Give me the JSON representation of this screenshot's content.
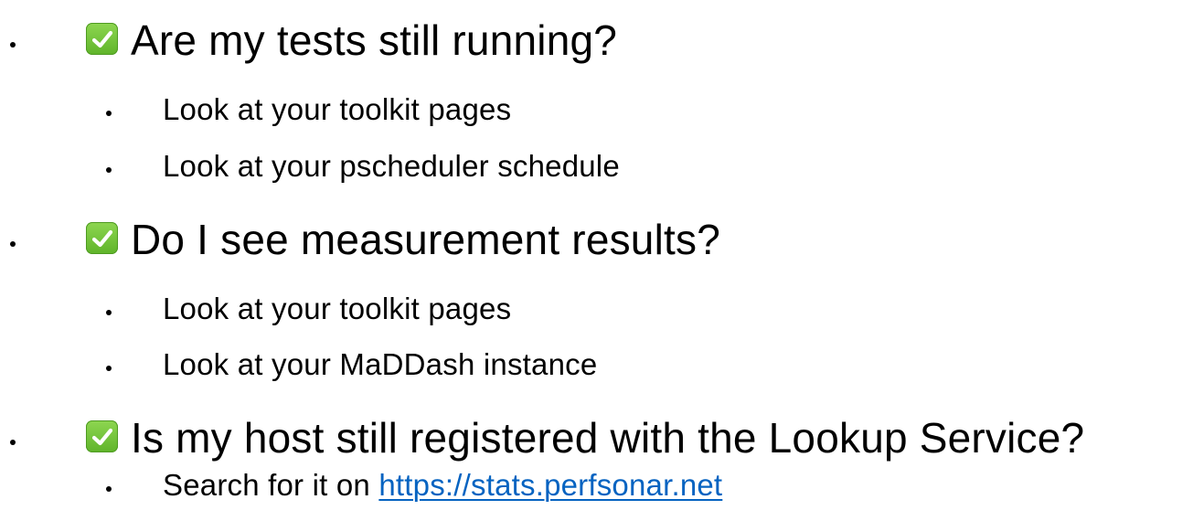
{
  "items": [
    {
      "text": "Are my tests still running?",
      "status_icon": "checkmark-box-icon",
      "subitems": [
        {
          "text": "Look at your toolkit pages"
        },
        {
          "text": "Look at your pscheduler schedule"
        }
      ]
    },
    {
      "text": "Do I see measurement results?",
      "status_icon": "checkmark-box-icon",
      "subitems": [
        {
          "text": "Look at your toolkit pages"
        },
        {
          "text": "Look at your MaDDash instance"
        }
      ]
    },
    {
      "text": "Is my host still registered with the Lookup Service?",
      "status_icon": "checkmark-box-icon",
      "subitems": [
        {
          "text": "Search for it on ",
          "link": "https://stats.perfsonar.net"
        }
      ]
    }
  ],
  "colors": {
    "check_green": "#6cc13a",
    "link": "#0563c1",
    "text": "#000000"
  }
}
